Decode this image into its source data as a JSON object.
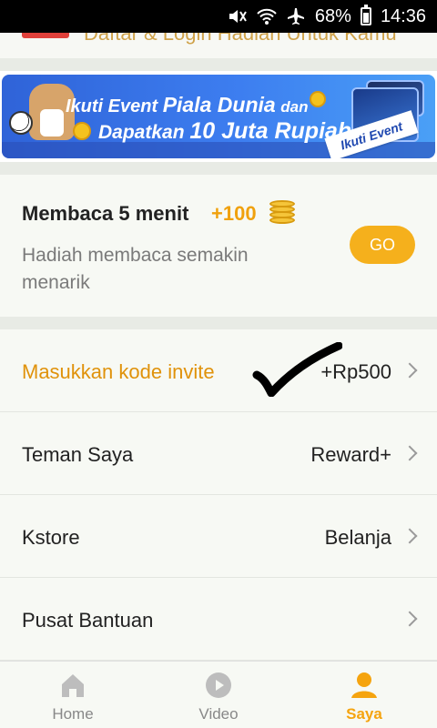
{
  "status_bar": {
    "battery": "68%",
    "time": "14:36",
    "icons": [
      "mute-icon",
      "wifi-icon",
      "airplane-icon",
      "battery-icon"
    ]
  },
  "top_strip": {
    "text": "Daftar & Login Hadiah Untuk Kamu"
  },
  "banner": {
    "line1_a": "Ikuti Event",
    "line1_b": "Piala Dunia",
    "line1_c": "dan",
    "line2_a": "Dapatkan",
    "line2_b": "10 Juta Rupiah",
    "tag": "Ikuti Event"
  },
  "reading": {
    "title": "Membaca 5 menit",
    "bonus": "+100",
    "description": "Hadiah membaca semakin menarik",
    "button": "GO"
  },
  "menu": [
    {
      "label": "Masukkan kode invite",
      "value": "+Rp500",
      "highlight": true
    },
    {
      "label": "Teman Saya",
      "value": "Reward+"
    },
    {
      "label": "Kstore",
      "value": "Belanja"
    },
    {
      "label": "Pusat Bantuan",
      "value": ""
    }
  ],
  "bottom_nav": [
    {
      "label": "Home",
      "icon": "home-icon"
    },
    {
      "label": "Video",
      "icon": "play-icon"
    },
    {
      "label": "Saya",
      "icon": "user-icon",
      "active": true
    }
  ],
  "colors": {
    "accent": "#f5b01c",
    "orange_text": "#e0920a",
    "banner_blue": "#3d7ef0"
  }
}
